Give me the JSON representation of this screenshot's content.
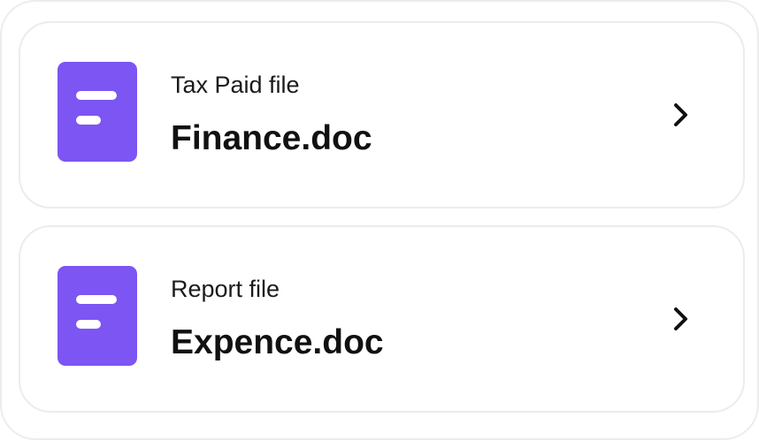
{
  "colors": {
    "icon_background": "#7c55f3",
    "card_border": "#ececec",
    "text": "#111111"
  },
  "files": [
    {
      "subtitle": "Tax Paid file",
      "name": "Finance.doc",
      "icon": "document-icon",
      "action_icon": "chevron-right-icon"
    },
    {
      "subtitle": "Report file",
      "name": "Expence.doc",
      "icon": "document-icon",
      "action_icon": "chevron-right-icon"
    }
  ]
}
